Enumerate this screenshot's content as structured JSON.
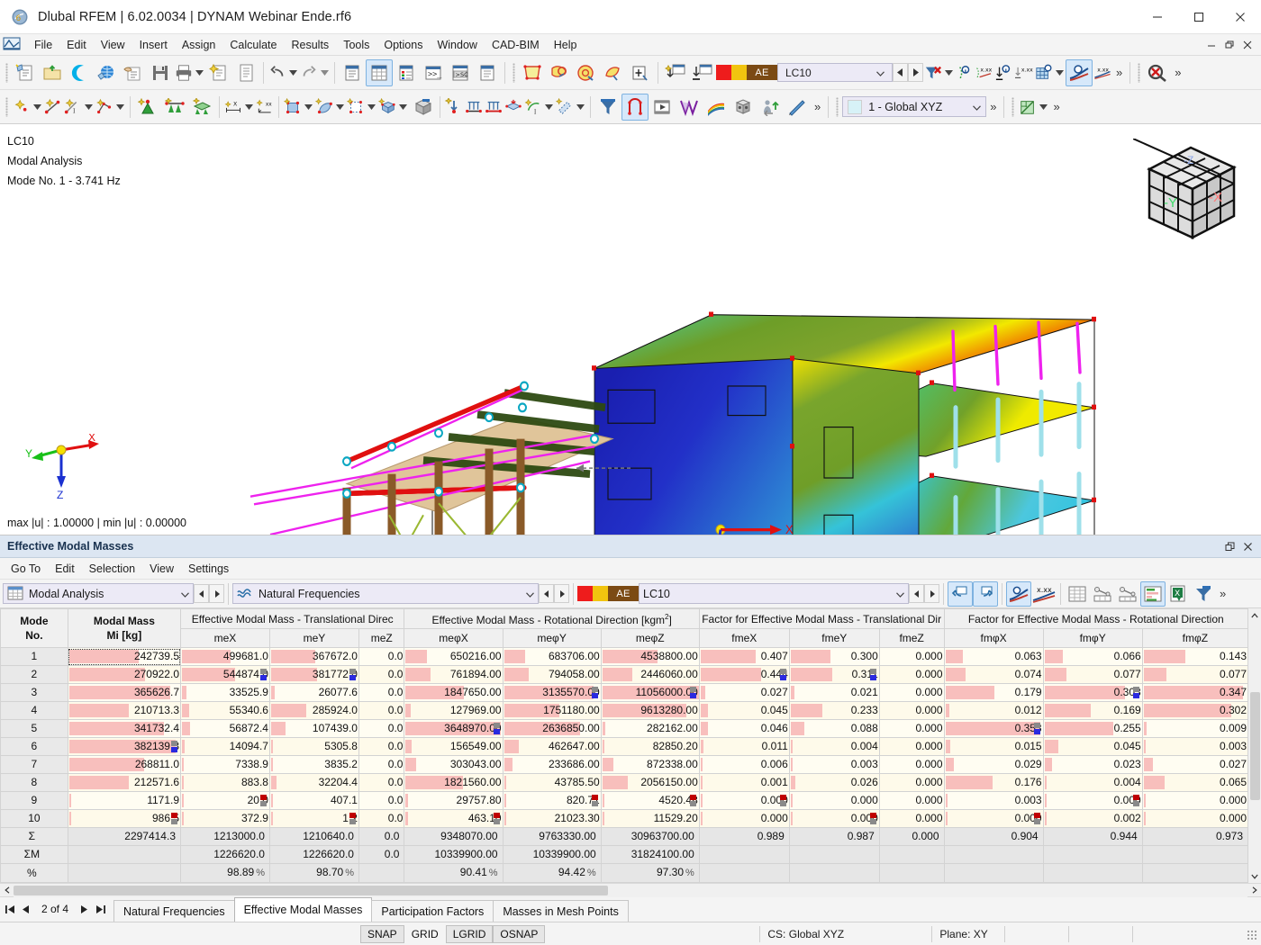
{
  "window": {
    "title": "Dlubal RFEM | 6.02.0034 | DYNAM Webinar Ende.rf6",
    "app_icon": "dlubal-rfem-icon",
    "minimize": "–",
    "maximize": "☐",
    "close": "✕"
  },
  "menubar": {
    "items": [
      {
        "label": "File"
      },
      {
        "label": "Edit"
      },
      {
        "label": "View"
      },
      {
        "label": "Insert"
      },
      {
        "label": "Assign"
      },
      {
        "label": "Calculate"
      },
      {
        "label": "Results"
      },
      {
        "label": "Tools"
      },
      {
        "label": "Options"
      },
      {
        "label": "Window"
      },
      {
        "label": "CAD-BIM"
      },
      {
        "label": "Help"
      }
    ],
    "mdi": {
      "minimize": "–",
      "restore": "❐",
      "close": "✕"
    }
  },
  "toolbar": {
    "load_case": "LC10",
    "ae_label": "AE",
    "swatch_red": "#ee1c1c",
    "swatch_yellow": "#f1c40f",
    "swatch_ae": "#7b4a14",
    "coord_system": "1 - Global XYZ",
    "overflow": "»"
  },
  "viewport": {
    "info_line1": "LC10",
    "info_line2": "Modal Analysis",
    "info_line3": "Mode No. 1 - 3.741 Hz",
    "minmax": "max |u| : 1.00000 | min |u| : 0.00000",
    "axis_x": "X",
    "axis_y": "Y",
    "axis_z": "Z",
    "model_axis_x": "X",
    "model_axis_z": "Z",
    "cube_label_y": "-Y",
    "cube_label_x": "-X",
    "cube_label_z": "-Z"
  },
  "panel": {
    "title": "Effective Modal Masses",
    "restore_icon": "❐",
    "close_icon": "✕",
    "menu": [
      {
        "label": "Go To"
      },
      {
        "label": "Edit"
      },
      {
        "label": "Selection"
      },
      {
        "label": "View"
      },
      {
        "label": "Settings"
      }
    ],
    "combo_analysis": "Modal Analysis",
    "combo_table": "Natural Frequencies",
    "combo_loadcase": "LC10",
    "ae_label": "AE",
    "overflow": "»"
  },
  "table": {
    "group_headers": [
      {
        "label": "",
        "span": 1
      },
      {
        "label": "",
        "span": 1
      },
      {
        "label": "Effective Modal Mass - Translational Direc",
        "span": 3
      },
      {
        "label": "Effective Modal Mass - Rotational Direction [kgm2]",
        "span": 3
      },
      {
        "label": "Factor for Effective Modal Mass - Translational Dir",
        "span": 3
      },
      {
        "label": "Factor for Effective Modal Mass - Rotational Direction",
        "span": 3
      }
    ],
    "sub_headers": [
      "Mode\nNo.",
      "Modal Mass\nMi [kg]",
      "meX",
      "meY",
      "meZ",
      "meφX",
      "meφY",
      "meφZ",
      "fmeX",
      "fmeY",
      "fmeZ",
      "fmφX",
      "fmφY",
      "fmφZ"
    ],
    "header_mode_l1": "Mode",
    "header_mode_l2": "No.",
    "header_mass_l1": "Modal Mass",
    "header_mass_l2": "Mi [kg]",
    "rows": [
      {
        "mode": "1",
        "cells": [
          "242739.5",
          "499681.0",
          "367672.0",
          "0.0",
          "650216.00",
          "683706.00",
          "4538800.00",
          "0.407",
          "0.300",
          "0.000",
          "0.063",
          "0.066",
          "0.143"
        ],
        "bars": [
          62,
          55,
          50,
          0,
          22,
          22,
          57,
          62,
          45,
          0,
          18,
          19,
          40
        ],
        "flags": [
          null,
          null,
          null,
          null,
          null,
          null,
          null,
          null,
          null,
          null,
          null,
          null,
          null
        ]
      },
      {
        "mode": "2",
        "cells": [
          "270922.0",
          "544874.0",
          "381772.0",
          "0.0",
          "761894.00",
          "794058.00",
          "2446060.00",
          "0.444",
          "0.311",
          "0.000",
          "0.074",
          "0.077",
          "0.077"
        ],
        "bars": [
          68,
          60,
          52,
          0,
          25,
          25,
          31,
          68,
          47,
          0,
          21,
          22,
          22
        ],
        "flags": [
          null,
          "gray-blue",
          "gray-blue",
          null,
          null,
          null,
          null,
          "gray-blue",
          "gray-blue",
          null,
          null,
          null,
          null
        ]
      },
      {
        "mode": "3",
        "cells": [
          "365626.7",
          "33525.9",
          "26077.6",
          "0.0",
          "1847650.00",
          "3135570.00",
          "11056000.00",
          "0.027",
          "0.021",
          "0.000",
          "0.179",
          "0.303",
          "0.347"
        ],
        "bars": [
          90,
          5,
          4,
          0,
          60,
          92,
          99,
          5,
          4,
          0,
          50,
          82,
          95
        ],
        "flags": [
          null,
          null,
          null,
          null,
          null,
          "gray-blue",
          "gray-blue",
          null,
          null,
          null,
          null,
          "gray-blue",
          null
        ]
      },
      {
        "mode": "4",
        "cells": [
          "210713.3",
          "55340.6",
          "285924.0",
          "0.0",
          "127969.00",
          "1751180.00",
          "9613280.00",
          "0.045",
          "0.233",
          "0.000",
          "0.012",
          "0.169",
          "0.302"
        ],
        "bars": [
          53,
          8,
          40,
          0,
          5,
          57,
          86,
          8,
          36,
          0,
          4,
          47,
          84
        ],
        "flags": [
          null,
          null,
          null,
          null,
          null,
          null,
          null,
          null,
          null,
          null,
          null,
          null,
          null
        ]
      },
      {
        "mode": "5",
        "cells": [
          "341732.4",
          "56872.4",
          "107439.0",
          "0.0",
          "3648970.00",
          "2636850.00",
          "282162.00",
          "0.046",
          "0.088",
          "0.000",
          "0.353",
          "0.255",
          "0.009"
        ],
        "bars": [
          85,
          9,
          16,
          0,
          98,
          78,
          3,
          8,
          15,
          0,
          97,
          70,
          3
        ],
        "flags": [
          null,
          null,
          null,
          null,
          "gray-blue",
          null,
          null,
          null,
          null,
          null,
          "gray-blue",
          null,
          null
        ]
      },
      {
        "mode": "6",
        "cells": [
          "382139.3",
          "14094.7",
          "5305.8",
          "0.0",
          "156549.00",
          "462647.00",
          "82850.20",
          "0.011",
          "0.004",
          "0.000",
          "0.015",
          "0.045",
          "0.003"
        ],
        "bars": [
          95,
          3,
          2,
          0,
          6,
          15,
          2,
          3,
          2,
          0,
          5,
          14,
          2
        ],
        "flags": [
          "gray-blue",
          null,
          null,
          null,
          null,
          null,
          null,
          null,
          null,
          null,
          null,
          null,
          null
        ]
      },
      {
        "mode": "7",
        "cells": [
          "268811.0",
          "7338.9",
          "3835.2",
          "0.0",
          "303043.00",
          "233686.00",
          "872338.00",
          "0.006",
          "0.003",
          "0.000",
          "0.029",
          "0.023",
          "0.027"
        ],
        "bars": [
          67,
          2,
          2,
          0,
          11,
          9,
          11,
          2,
          2,
          0,
          9,
          8,
          9
        ],
        "flags": [
          null,
          null,
          null,
          null,
          null,
          null,
          null,
          null,
          null,
          null,
          null,
          null,
          null
        ]
      },
      {
        "mode": "8",
        "cells": [
          "212571.6",
          "883.8",
          "32204.4",
          "0.0",
          "1821560.00",
          "43785.50",
          "2056150.00",
          "0.001",
          "0.026",
          "0.000",
          "0.176",
          "0.004",
          "0.065"
        ],
        "bars": [
          53,
          1,
          6,
          0,
          59,
          2,
          26,
          1,
          5,
          0,
          48,
          2,
          20
        ],
        "flags": [
          null,
          null,
          null,
          null,
          null,
          null,
          null,
          null,
          null,
          null,
          null,
          null,
          null
        ]
      },
      {
        "mode": "9",
        "cells": [
          "1171.9",
          "20.0",
          "407.1",
          "0.0",
          "29757.80",
          "820.71",
          "4520.48",
          "0.000",
          "0.000",
          "0.000",
          "0.003",
          "0.000",
          "0.000"
        ],
        "bars": [
          1,
          1,
          1,
          0,
          2,
          1,
          1,
          1,
          1,
          0,
          1,
          1,
          1
        ],
        "flags": [
          null,
          "red-gray",
          null,
          null,
          null,
          "red-gray",
          "red-gray",
          "red-gray",
          null,
          null,
          null,
          "red-gray",
          null
        ]
      },
      {
        "mode": "10",
        "cells": [
          "986.5",
          "372.9",
          "1.2",
          "0.0",
          "463.10",
          "21023.30",
          "11529.20",
          "0.000",
          "0.000",
          "0.000",
          "0.000",
          "0.002",
          "0.000"
        ],
        "bars": [
          1,
          1,
          1,
          0,
          1,
          1,
          1,
          1,
          1,
          0,
          1,
          1,
          1
        ],
        "flags": [
          "red-gray",
          null,
          "red-gray",
          null,
          "red-gray",
          null,
          null,
          null,
          "red-gray",
          null,
          "red-gray",
          null,
          null
        ]
      }
    ],
    "sum_row": {
      "label": "Σ",
      "cells": [
        "2297414.3",
        "1213000.0",
        "1210640.0",
        "0.0",
        "9348070.00",
        "9763330.00",
        "30963700.00",
        "0.989",
        "0.987",
        "0.000",
        "0.904",
        "0.944",
        "0.973"
      ]
    },
    "sum_m_row": {
      "label": "ΣM",
      "cells": [
        "",
        "1226620.0",
        "1226620.0",
        "0.0",
        "10339900.00",
        "10339900.00",
        "31824100.00",
        "",
        "",
        "",
        "",
        "",
        ""
      ]
    },
    "pct_row": {
      "label": "%",
      "suffix": "%",
      "cells": [
        "",
        "98.89",
        "98.70",
        "",
        "90.41",
        "94.42",
        "97.30",
        "",
        "",
        "",
        "",
        "",
        ""
      ]
    }
  },
  "tabbar": {
    "first": "⏮",
    "prev": "◀",
    "next": "▶",
    "last": "⏭",
    "page_label": "2 of 4",
    "tabs": [
      {
        "label": "Natural Frequencies",
        "selected": false
      },
      {
        "label": "Effective Modal Masses",
        "selected": true
      },
      {
        "label": "Participation Factors",
        "selected": false
      },
      {
        "label": "Masses in Mesh Points",
        "selected": false
      }
    ],
    "collapse_icon": "‹"
  },
  "statusbar": {
    "snap_buttons": [
      {
        "label": "SNAP",
        "on": true
      },
      {
        "label": "GRID",
        "on": false
      },
      {
        "label": "LGRID",
        "on": true
      },
      {
        "label": "OSNAP",
        "on": true
      }
    ],
    "cs": "CS: Global XYZ",
    "plane": "Plane: XY"
  }
}
